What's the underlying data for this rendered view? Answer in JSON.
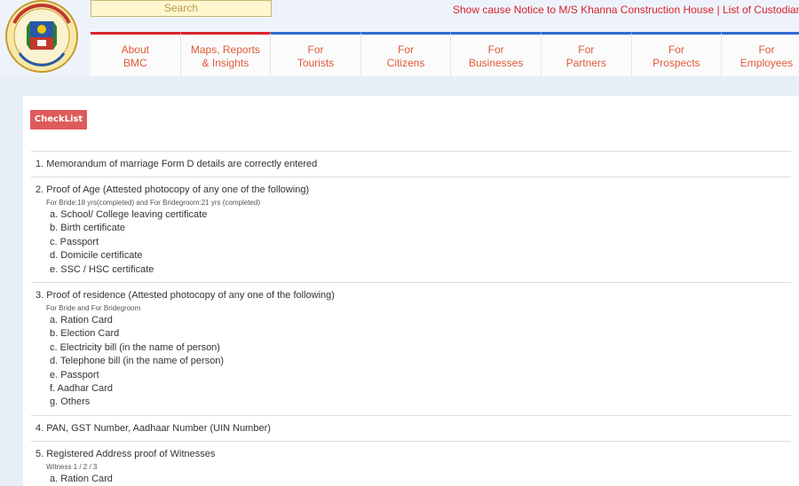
{
  "header": {
    "logo_text": "बृहन्मुंबई महानगरपालिका",
    "search_placeholder": "Search",
    "ticker": "Show cause Notice to M/S Khanna Construction House | List of Custodian of Advo",
    "nav": [
      {
        "line1": "About",
        "line2": "BMC"
      },
      {
        "line1": "Maps, Reports",
        "line2": "& Insights"
      },
      {
        "line1": "For",
        "line2": "Tourists"
      },
      {
        "line1": "For",
        "line2": "Citizens"
      },
      {
        "line1": "For",
        "line2": "Businesses"
      },
      {
        "line1": "For",
        "line2": "Partners"
      },
      {
        "line1": "For",
        "line2": "Prospects"
      },
      {
        "line1": "For",
        "line2": "Employees"
      }
    ]
  },
  "main": {
    "checklist_label": "CheckList",
    "items": [
      {
        "title": "1. Memorandum of marriage Form D details are correctly entered",
        "subtitle": "",
        "options": []
      },
      {
        "title": "2. Proof of Age (Attested photocopy of any one of the following)",
        "subtitle": "For Bride:18 yrs(completed) and For Bridegroom:21 yrs (completed)",
        "options": [
          "a. School/ College leaving certificate",
          "b. Birth certificate",
          "c. Passport",
          "d. Domicile certificate",
          "e. SSC / HSC certificate"
        ]
      },
      {
        "title": "3. Proof of residence (Attested photocopy of any one of the following)",
        "subtitle": "For Bride and For Bridegroom",
        "options": [
          "a. Ration Card",
          "b. Election Card",
          "c. Electricity bill (in the name of person)",
          "d. Telephone bill (in the name of person)",
          "e. Passport",
          "f. Aadhar Card",
          "g. Others"
        ]
      },
      {
        "title": "4. PAN, GST Number, Aadhaar Number (UIN Number)",
        "subtitle": "",
        "options": []
      },
      {
        "title": "5. Registered Address proof of Witnesses",
        "subtitle": "Witness 1 / 2 / 3",
        "options": [
          "a. Ration Card"
        ]
      }
    ]
  }
}
